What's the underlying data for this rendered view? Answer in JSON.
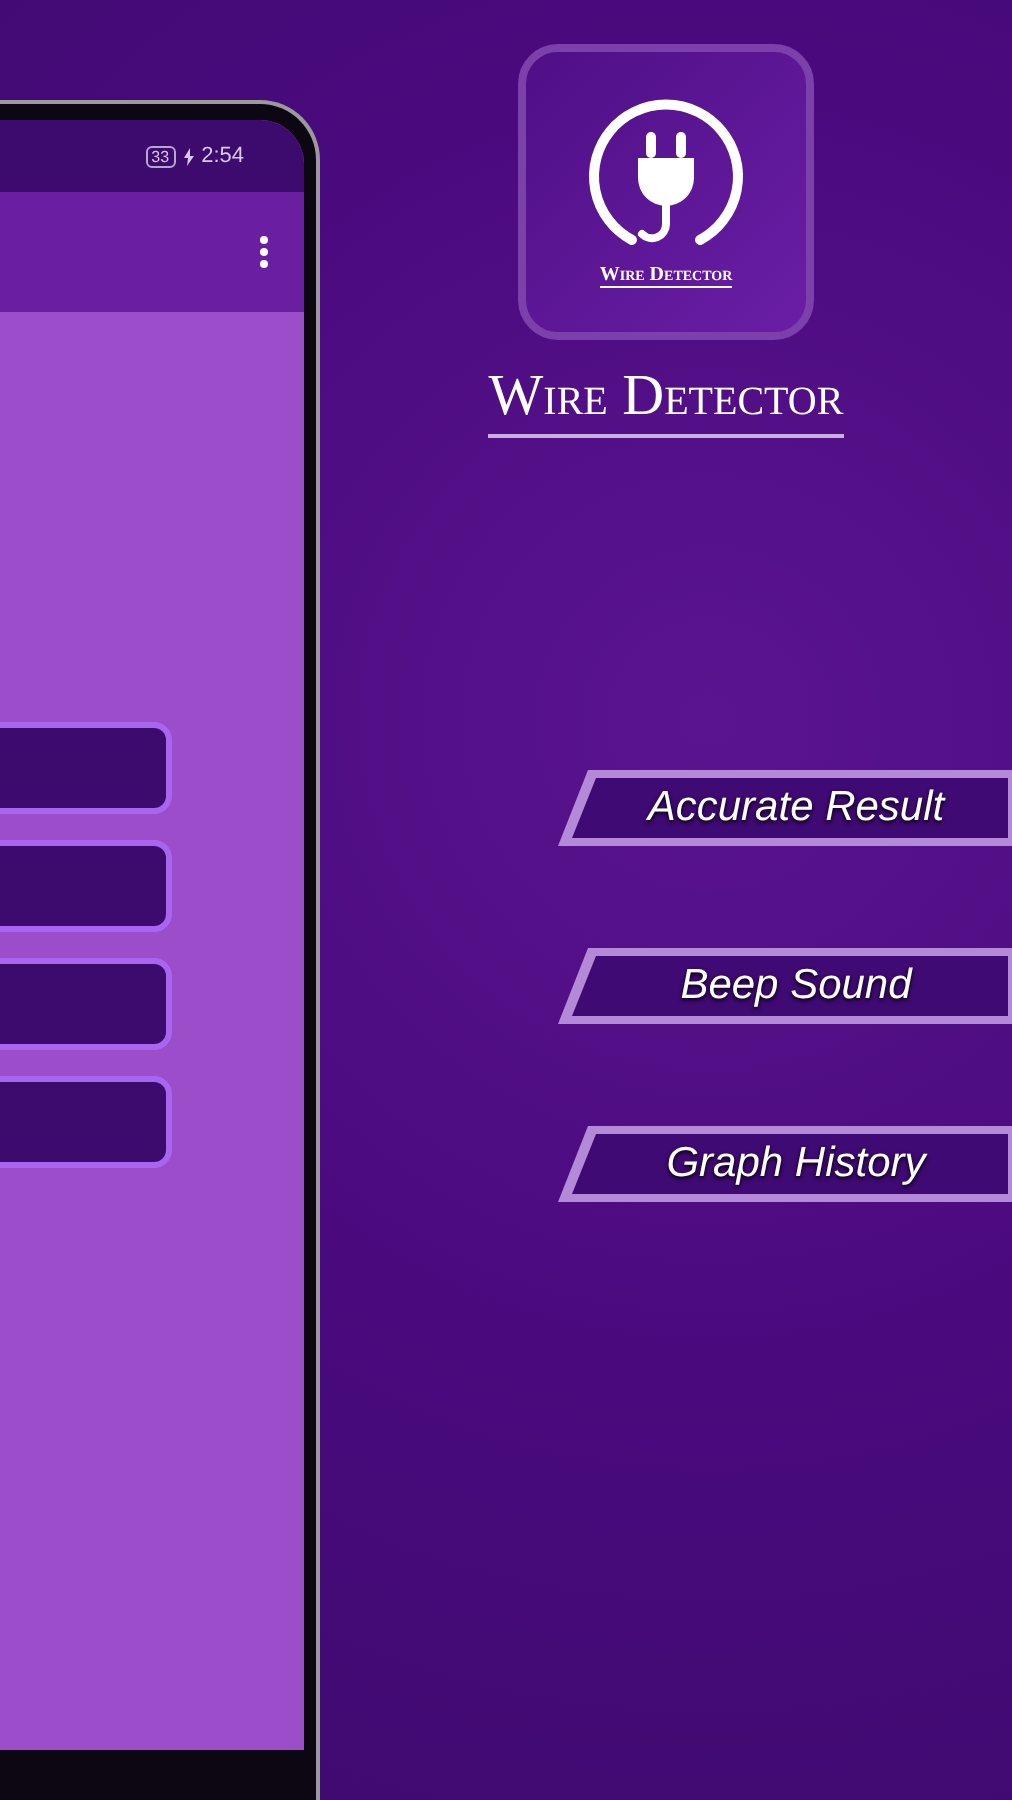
{
  "phone": {
    "status_bar": {
      "battery": "33",
      "time": "2:54",
      "charging": true
    },
    "menu_buttons": [
      {
        "kind": "button"
      },
      {
        "kind": "button"
      },
      {
        "kind": "button"
      },
      {
        "kind": "button"
      }
    ]
  },
  "app_icon": {
    "label": "Wire Detector"
  },
  "title": "Wire Detector",
  "features": [
    {
      "label": "Accurate Result"
    },
    {
      "label": "Beep Sound"
    },
    {
      "label": "Graph History"
    }
  ]
}
